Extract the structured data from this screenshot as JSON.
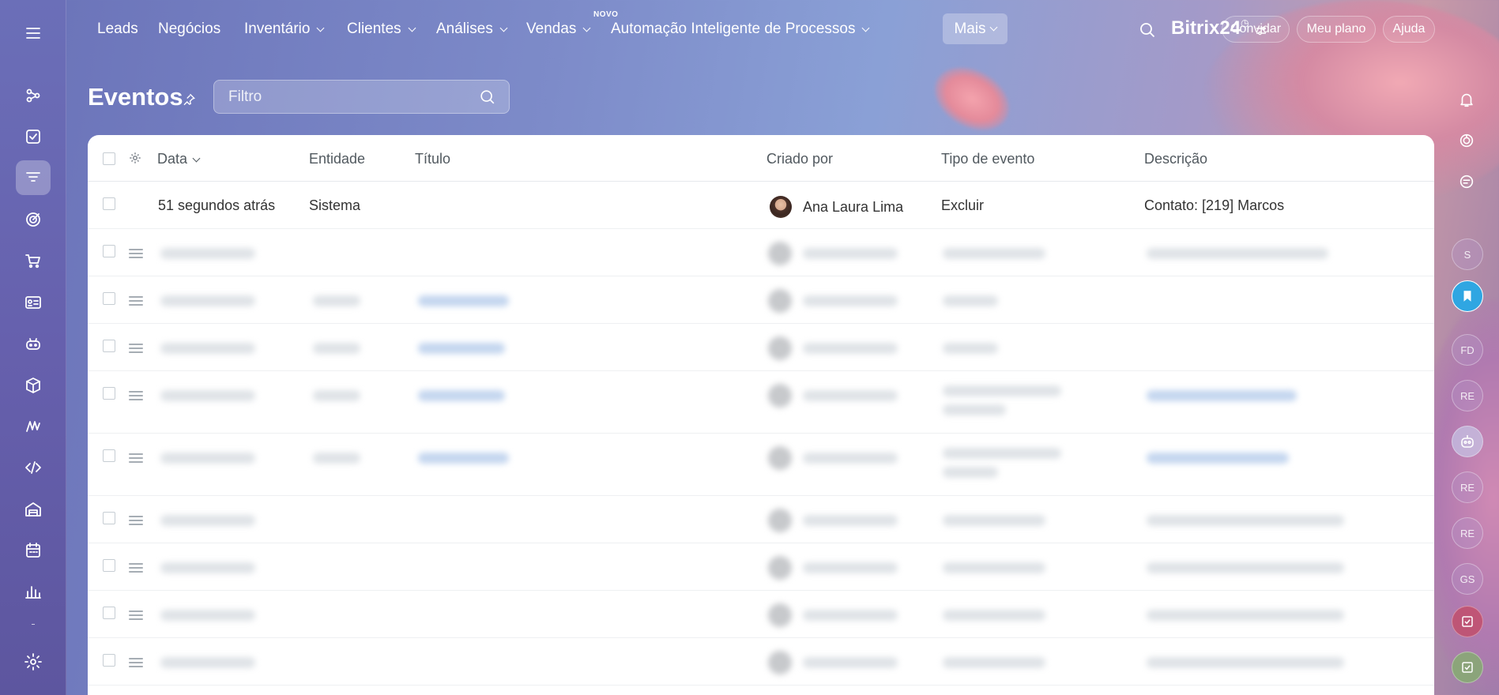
{
  "nav": {
    "items": [
      {
        "label": "Leads"
      },
      {
        "label": "Negócios"
      },
      {
        "label": "Inventário"
      },
      {
        "label": "Clientes"
      },
      {
        "label": "Análises"
      },
      {
        "label": "Vendas"
      },
      {
        "label": "Automação Inteligente de Processos"
      }
    ],
    "vendas_badge": "NOVO",
    "more_label": "Mais",
    "brand_name": "Bitrix",
    "brand_suffix": "24",
    "invite_label": "Convidar",
    "plan_label": "Meu plano",
    "help_label": "Ajuda"
  },
  "page": {
    "title": "Eventos",
    "filter_placeholder": "Filtro"
  },
  "table": {
    "columns": {
      "date": "Data",
      "entity": "Entidade",
      "title": "Título",
      "created_by": "Criado por",
      "event_type": "Tipo de evento",
      "description": "Descrição"
    },
    "rows": [
      {
        "date": "51 segundos atrás",
        "entity": "Sistema",
        "title": "",
        "created_by": "Ana Laura Lima",
        "event_type": "Excluir",
        "description": "Contato: [219] Marcos"
      }
    ]
  },
  "right_panel": {
    "avatars": [
      "S",
      "FD",
      "RE",
      "RE",
      "RE",
      "GS"
    ]
  },
  "colors": {
    "sidebar": "#6660ad",
    "accent_blue": "#2fa6e2",
    "table_text": "#333333",
    "header_text": "#51595f"
  }
}
